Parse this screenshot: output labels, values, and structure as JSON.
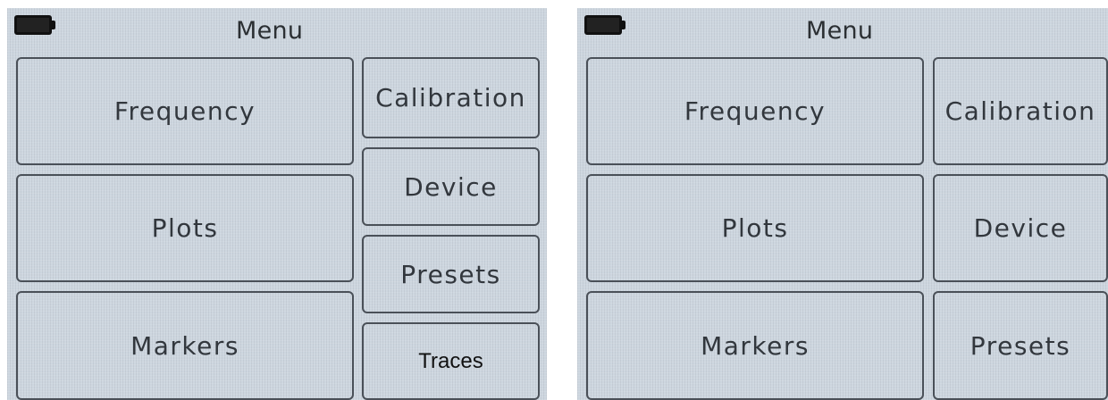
{
  "screens": [
    {
      "title": "Menu",
      "left_buttons": [
        "Frequency",
        "Plots",
        "Markers"
      ],
      "right_buttons": [
        "Calibration",
        "Device",
        "Presets",
        "Traces"
      ]
    },
    {
      "title": "Menu",
      "left_buttons": [
        "Frequency",
        "Plots",
        "Markers"
      ],
      "right_buttons": [
        "Calibration",
        "Device",
        "Presets"
      ]
    }
  ]
}
